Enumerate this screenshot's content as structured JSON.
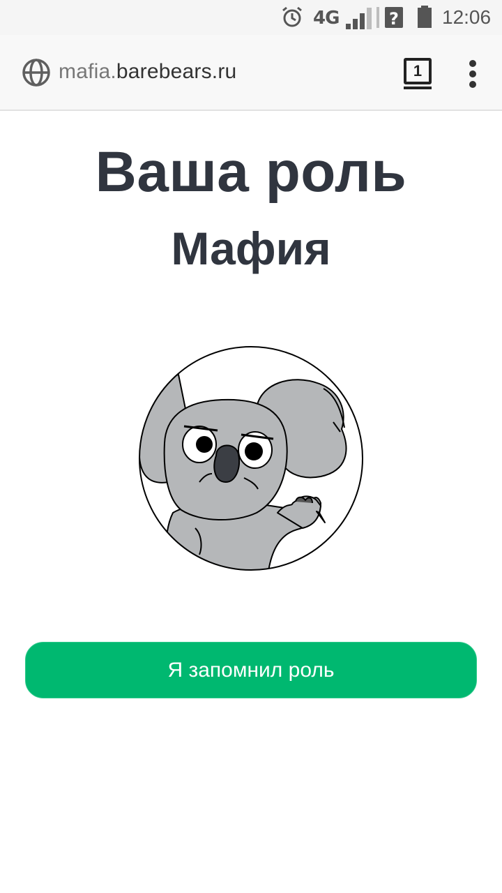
{
  "status_bar": {
    "network": "4G",
    "time": "12:06",
    "icons": [
      "alarm-icon",
      "signal-icon",
      "wifi-unknown-icon",
      "battery-icon"
    ]
  },
  "browser": {
    "url_subdomain": "mafia.",
    "url_domain": "barebears.ru",
    "tab_count": "1",
    "icons": [
      "globe-icon",
      "overflow-menu-icon"
    ]
  },
  "page": {
    "title": "Ваша роль",
    "role": "Мафия",
    "avatar_icon": "koala-avatar-icon",
    "confirm_button": "Я запомнил роль"
  },
  "colors": {
    "accent": "#00b870",
    "text": "#30353f",
    "koala_fur": "#b5b7b9"
  }
}
